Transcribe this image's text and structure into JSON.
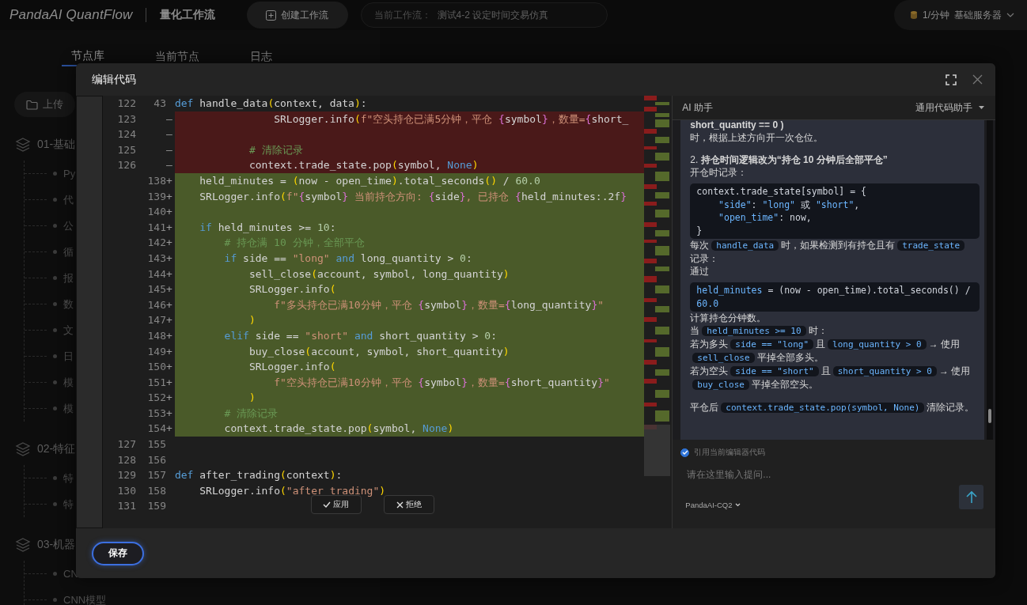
{
  "app": {
    "logo": "PandaAI QuantFlow",
    "section": "量化工作流",
    "create_button": "创建工作流",
    "current_workflow": {
      "label": "当前工作流：",
      "value": "测试4-2 设定时间交易仿真"
    },
    "quota": "1/分钟",
    "server": "基础服务器"
  },
  "panel_tabs": [
    {
      "label": "节点库",
      "selected": true
    },
    {
      "label": "当前节点",
      "selected": false
    },
    {
      "label": "日志",
      "selected": false
    }
  ],
  "upload_button": "上传",
  "node_groups": [
    {
      "label": "01-基础",
      "items": [
        "Py",
        "代",
        "公",
        "循",
        "报",
        "数",
        "文",
        "日",
        "模",
        "模"
      ]
    },
    {
      "label": "02-特征",
      "items": [
        "特",
        "特"
      ]
    },
    {
      "label": "03-机器",
      "items": [
        "CN",
        "CNN模型"
      ]
    }
  ],
  "dialog": {
    "title": "编辑代码",
    "code_lines": [
      {
        "kind": "context",
        "old_number": "122",
        "new_number": "43",
        "tokens": [
          {
            "kind": "kw",
            "text": "def"
          },
          {
            "kind": "plain",
            "text": " handle_data"
          },
          {
            "kind": "paren",
            "text": "("
          },
          {
            "kind": "plain",
            "text": "context, data"
          },
          {
            "kind": "paren",
            "text": ")"
          },
          {
            "kind": "plain",
            "text": ":"
          }
        ]
      },
      {
        "kind": "deleted",
        "old_number": "123",
        "marker": "—",
        "tokens": [
          {
            "kind": "plain",
            "text": "                SRLogger.info"
          },
          {
            "kind": "paren",
            "text": "("
          },
          {
            "kind": "str",
            "text": "f\"空头持仓已满5分钟，平仓 "
          },
          {
            "kind": "brace",
            "text": "{"
          },
          {
            "kind": "plain",
            "text": "symbol"
          },
          {
            "kind": "brace",
            "text": "}"
          },
          {
            "kind": "str",
            "text": "，数量="
          },
          {
            "kind": "brace",
            "text": "{"
          },
          {
            "kind": "plain",
            "text": "short_"
          }
        ]
      },
      {
        "kind": "deleted",
        "old_number": "124",
        "marker": "—"
      },
      {
        "kind": "deleted",
        "old_number": "125",
        "marker": "—",
        "tokens": [
          {
            "kind": "cmt",
            "text": "            # 清除记录"
          }
        ]
      },
      {
        "kind": "deleted",
        "old_number": "126",
        "marker": "—",
        "tokens": [
          {
            "kind": "plain",
            "text": "            context.trade_state.pop"
          },
          {
            "kind": "paren",
            "text": "("
          },
          {
            "kind": "plain",
            "text": "symbol, "
          },
          {
            "kind": "kw",
            "text": "None"
          },
          {
            "kind": "paren",
            "text": ")"
          }
        ]
      },
      {
        "kind": "added",
        "new_number": "138",
        "marker": "+",
        "tokens": [
          {
            "kind": "plain",
            "text": "    held_minutes = "
          },
          {
            "kind": "paren",
            "text": "("
          },
          {
            "kind": "plain",
            "text": "now - open_time"
          },
          {
            "kind": "paren",
            "text": ")"
          },
          {
            "kind": "plain",
            "text": ".total_seconds"
          },
          {
            "kind": "paren",
            "text": "()"
          },
          {
            "kind": "plain",
            "text": " / "
          },
          {
            "kind": "num",
            "text": "60.0"
          }
        ]
      },
      {
        "kind": "added",
        "new_number": "139",
        "marker": "+",
        "tokens": [
          {
            "kind": "plain",
            "text": "    SRLogger.info"
          },
          {
            "kind": "paren",
            "text": "("
          },
          {
            "kind": "str",
            "text": "f\""
          },
          {
            "kind": "brace",
            "text": "{"
          },
          {
            "kind": "plain",
            "text": "symbol"
          },
          {
            "kind": "brace",
            "text": "}"
          },
          {
            "kind": "str",
            "text": " 当前持仓方向: "
          },
          {
            "kind": "brace",
            "text": "{"
          },
          {
            "kind": "plain",
            "text": "side"
          },
          {
            "kind": "brace",
            "text": "}"
          },
          {
            "kind": "str",
            "text": ", 已持仓 "
          },
          {
            "kind": "brace",
            "text": "{"
          },
          {
            "kind": "plain",
            "text": "held_minutes:.2f"
          },
          {
            "kind": "brace",
            "text": "}"
          }
        ]
      },
      {
        "kind": "added",
        "new_number": "140",
        "marker": "+"
      },
      {
        "kind": "added",
        "new_number": "141",
        "marker": "+",
        "tokens": [
          {
            "kind": "kw",
            "text": "    if"
          },
          {
            "kind": "plain",
            "text": " held_minutes >= "
          },
          {
            "kind": "num",
            "text": "10"
          },
          {
            "kind": "plain",
            "text": ":"
          }
        ]
      },
      {
        "kind": "added",
        "new_number": "142",
        "marker": "+",
        "tokens": [
          {
            "kind": "cmt",
            "text": "        # 持仓满 10 分钟，全部平仓"
          }
        ]
      },
      {
        "kind": "added",
        "new_number": "143",
        "marker": "+",
        "tokens": [
          {
            "kind": "kw",
            "text": "        if"
          },
          {
            "kind": "plain",
            "text": " side == "
          },
          {
            "kind": "str",
            "text": "\"long\""
          },
          {
            "kind": "kw",
            "text": " and"
          },
          {
            "kind": "plain",
            "text": " long_quantity > "
          },
          {
            "kind": "num",
            "text": "0"
          },
          {
            "kind": "plain",
            "text": ":"
          }
        ]
      },
      {
        "kind": "added",
        "new_number": "144",
        "marker": "+",
        "tokens": [
          {
            "kind": "plain",
            "text": "            sell_close"
          },
          {
            "kind": "paren",
            "text": "("
          },
          {
            "kind": "plain",
            "text": "account, symbol, long_quantity"
          },
          {
            "kind": "paren",
            "text": ")"
          }
        ]
      },
      {
        "kind": "added",
        "new_number": "145",
        "marker": "+",
        "tokens": [
          {
            "kind": "plain",
            "text": "            SRLogger.info"
          },
          {
            "kind": "paren",
            "text": "("
          }
        ]
      },
      {
        "kind": "added",
        "new_number": "146",
        "marker": "+",
        "tokens": [
          {
            "kind": "str",
            "text": "                f\"多头持仓已满10分钟，平仓 "
          },
          {
            "kind": "brace",
            "text": "{"
          },
          {
            "kind": "plain",
            "text": "symbol"
          },
          {
            "kind": "brace",
            "text": "}"
          },
          {
            "kind": "str",
            "text": "，数量="
          },
          {
            "kind": "brace",
            "text": "{"
          },
          {
            "kind": "plain",
            "text": "long_quantity"
          },
          {
            "kind": "brace",
            "text": "}"
          },
          {
            "kind": "str",
            "text": "\""
          }
        ]
      },
      {
        "kind": "added",
        "new_number": "147",
        "marker": "+",
        "tokens": [
          {
            "kind": "paren",
            "text": "            )"
          }
        ]
      },
      {
        "kind": "added",
        "new_number": "148",
        "marker": "+",
        "tokens": [
          {
            "kind": "kw",
            "text": "        elif"
          },
          {
            "kind": "plain",
            "text": " side == "
          },
          {
            "kind": "str",
            "text": "\"short\""
          },
          {
            "kind": "kw",
            "text": " and"
          },
          {
            "kind": "plain",
            "text": " short_quantity > "
          },
          {
            "kind": "num",
            "text": "0"
          },
          {
            "kind": "plain",
            "text": ":"
          }
        ]
      },
      {
        "kind": "added",
        "new_number": "149",
        "marker": "+",
        "tokens": [
          {
            "kind": "plain",
            "text": "            buy_close"
          },
          {
            "kind": "paren",
            "text": "("
          },
          {
            "kind": "plain",
            "text": "account, symbol, short_quantity"
          },
          {
            "kind": "paren",
            "text": ")"
          }
        ]
      },
      {
        "kind": "added",
        "new_number": "150",
        "marker": "+",
        "tokens": [
          {
            "kind": "plain",
            "text": "            SRLogger.info"
          },
          {
            "kind": "paren",
            "text": "("
          }
        ]
      },
      {
        "kind": "added",
        "new_number": "151",
        "marker": "+",
        "tokens": [
          {
            "kind": "str",
            "text": "                f\"空头持仓已满10分钟，平仓 "
          },
          {
            "kind": "brace",
            "text": "{"
          },
          {
            "kind": "plain",
            "text": "symbol"
          },
          {
            "kind": "brace",
            "text": "}"
          },
          {
            "kind": "str",
            "text": "，数量="
          },
          {
            "kind": "brace",
            "text": "{"
          },
          {
            "kind": "plain",
            "text": "short_quantity"
          },
          {
            "kind": "brace",
            "text": "}"
          },
          {
            "kind": "str",
            "text": "\""
          }
        ]
      },
      {
        "kind": "added",
        "new_number": "152",
        "marker": "+",
        "tokens": [
          {
            "kind": "paren",
            "text": "            )"
          }
        ]
      },
      {
        "kind": "added",
        "new_number": "153",
        "marker": "+",
        "tokens": [
          {
            "kind": "cmt",
            "text": "        # 清除记录"
          }
        ]
      },
      {
        "kind": "added",
        "new_number": "154",
        "marker": "+",
        "tokens": [
          {
            "kind": "plain",
            "text": "        context.trade_state.pop"
          },
          {
            "kind": "paren",
            "text": "("
          },
          {
            "kind": "plain",
            "text": "symbol, "
          },
          {
            "kind": "kw",
            "text": "None"
          },
          {
            "kind": "paren",
            "text": ")"
          }
        ]
      },
      {
        "kind": "context",
        "old_number": "127",
        "new_number": "155"
      },
      {
        "kind": "context",
        "old_number": "128",
        "new_number": "156"
      },
      {
        "kind": "context",
        "old_number": "129",
        "new_number": "157",
        "tokens": [
          {
            "kind": "kw",
            "text": "def"
          },
          {
            "kind": "plain",
            "text": " after_trading"
          },
          {
            "kind": "paren",
            "text": "("
          },
          {
            "kind": "plain",
            "text": "context"
          },
          {
            "kind": "paren",
            "text": ")"
          },
          {
            "kind": "plain",
            "text": ":"
          }
        ]
      },
      {
        "kind": "context",
        "old_number": "130",
        "new_number": "158",
        "tokens": [
          {
            "kind": "plain",
            "text": "    SRLogger.info"
          },
          {
            "kind": "paren",
            "text": "("
          },
          {
            "kind": "str",
            "text": "\"after_trading\""
          },
          {
            "kind": "paren",
            "text": ")"
          }
        ]
      },
      {
        "kind": "context",
        "old_number": "131",
        "new_number": "159"
      }
    ],
    "apply_button": "应用",
    "reject_button": "拒绝",
    "save_button": "保存"
  },
  "assistant": {
    "title": "AI 助手",
    "mode": "通用代码助手",
    "message": [
      {
        "kind": "bold",
        "text": "short_quantity == 0 )"
      },
      {
        "kind": "para",
        "segments": [
          {
            "kind": "text",
            "text": "时，根据上述方向开一次仓位。"
          }
        ]
      },
      {
        "kind": "break"
      },
      {
        "kind": "rich",
        "text": "2. **持仓时间逻辑改为“持仓 10 分钟后全部平仓”**"
      },
      {
        "kind": "para",
        "segments": [
          {
            "kind": "text",
            "text": "开仓时记录："
          }
        ]
      },
      {
        "kind": "code",
        "lines": [
          [
            {
              "kind": "plain",
              "text": "context.trade_state[symbol] = {"
            }
          ],
          [
            {
              "kind": "str",
              "text": "    \"side\""
            },
            {
              "kind": "plain",
              "text": ": "
            },
            {
              "kind": "str",
              "text": "\"long\""
            },
            {
              "kind": "plain",
              "text": " 或 "
            },
            {
              "kind": "str",
              "text": "\"short\""
            },
            {
              "kind": "plain",
              "text": ","
            }
          ],
          [
            {
              "kind": "str",
              "text": "    \"open_time\""
            },
            {
              "kind": "plain",
              "text": ": now,"
            }
          ],
          [
            {
              "kind": "plain",
              "text": "}"
            }
          ]
        ]
      },
      {
        "kind": "para",
        "segments": [
          {
            "kind": "text",
            "text": "每次"
          },
          {
            "kind": "code",
            "text": "handle_data"
          },
          {
            "kind": "text",
            "text": "时，如果检测到有持仓且有"
          },
          {
            "kind": "code",
            "text": "trade_state"
          },
          {
            "kind": "text",
            "text": "记录："
          }
        ]
      },
      {
        "kind": "para",
        "segments": [
          {
            "kind": "text",
            "text": "通过"
          }
        ]
      },
      {
        "kind": "code",
        "lines": [
          [
            {
              "kind": "str",
              "text": "held_minutes"
            },
            {
              "kind": "plain",
              "text": " = (now - open_time).total_seconds() / "
            },
            {
              "kind": "str",
              "text": "60.0"
            }
          ]
        ]
      },
      {
        "kind": "para",
        "segments": [
          {
            "kind": "text",
            "text": "计算持仓分钟数。"
          }
        ]
      },
      {
        "kind": "para",
        "segments": [
          {
            "kind": "text",
            "text": "当"
          },
          {
            "kind": "code",
            "text": "held_minutes >= 10"
          },
          {
            "kind": "text",
            "text": "时："
          }
        ]
      },
      {
        "kind": "para",
        "segments": [
          {
            "kind": "text",
            "text": "若为多头"
          },
          {
            "kind": "code",
            "text": "side == \"long\""
          },
          {
            "kind": "text",
            "text": "且"
          },
          {
            "kind": "code",
            "text": "long_quantity > 0"
          },
          {
            "kind": "text",
            "text": "→ 使用"
          },
          {
            "kind": "code",
            "text": "sell_close"
          },
          {
            "kind": "text",
            "text": "平掉全部多头。"
          }
        ]
      },
      {
        "kind": "para",
        "segments": [
          {
            "kind": "text",
            "text": "若为空头"
          },
          {
            "kind": "code",
            "text": "side == \"short\""
          },
          {
            "kind": "text",
            "text": "且"
          },
          {
            "kind": "code",
            "text": "short_quantity > 0"
          },
          {
            "kind": "text",
            "text": "→ 使用"
          },
          {
            "kind": "code",
            "text": "buy_close"
          },
          {
            "kind": "text",
            "text": "平掉全部空头。"
          }
        ]
      },
      {
        "kind": "break"
      },
      {
        "kind": "para",
        "segments": [
          {
            "kind": "text",
            "text": "平仓后"
          },
          {
            "kind": "code",
            "text": "context.trade_state.pop(symbol, None)"
          },
          {
            "kind": "text",
            "text": "清除记录。"
          }
        ]
      }
    ],
    "quote_code": {
      "label": "引用当前编辑器代码",
      "checked": true
    },
    "input": {
      "placeholder": "请在这里输入提问..."
    },
    "model": "PandaAI-CQ2"
  }
}
